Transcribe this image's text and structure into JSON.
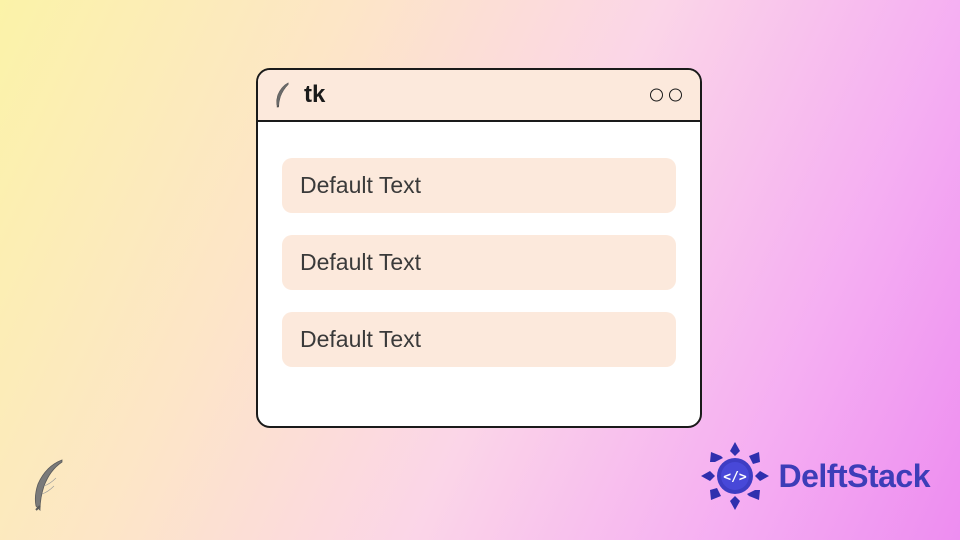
{
  "window": {
    "title": "tk",
    "entries": [
      {
        "value": "Default Text"
      },
      {
        "value": "Default Text"
      },
      {
        "value": "Default Text"
      }
    ]
  },
  "branding": {
    "name": "DelftStack"
  },
  "icons": {
    "feather": "feather-icon",
    "mandala": "mandala-logo"
  }
}
